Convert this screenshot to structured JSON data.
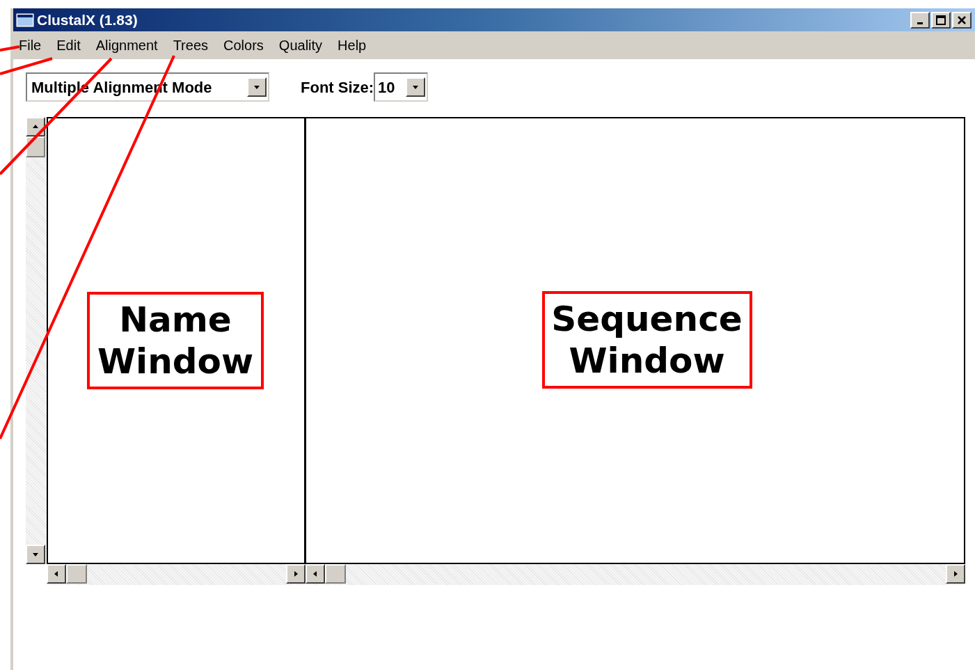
{
  "window": {
    "title": "ClustalX (1.83)"
  },
  "menu": [
    {
      "label": "File"
    },
    {
      "label": "Edit"
    },
    {
      "label": "Alignment"
    },
    {
      "label": "Trees"
    },
    {
      "label": "Colors"
    },
    {
      "label": "Quality"
    },
    {
      "label": "Help"
    }
  ],
  "toolbar": {
    "mode": "Multiple Alignment Mode",
    "font_size_label": "Font Size:",
    "font_size": "10"
  },
  "panes": [
    {
      "annotation": "Name Window"
    },
    {
      "annotation": "Sequence Window"
    }
  ]
}
